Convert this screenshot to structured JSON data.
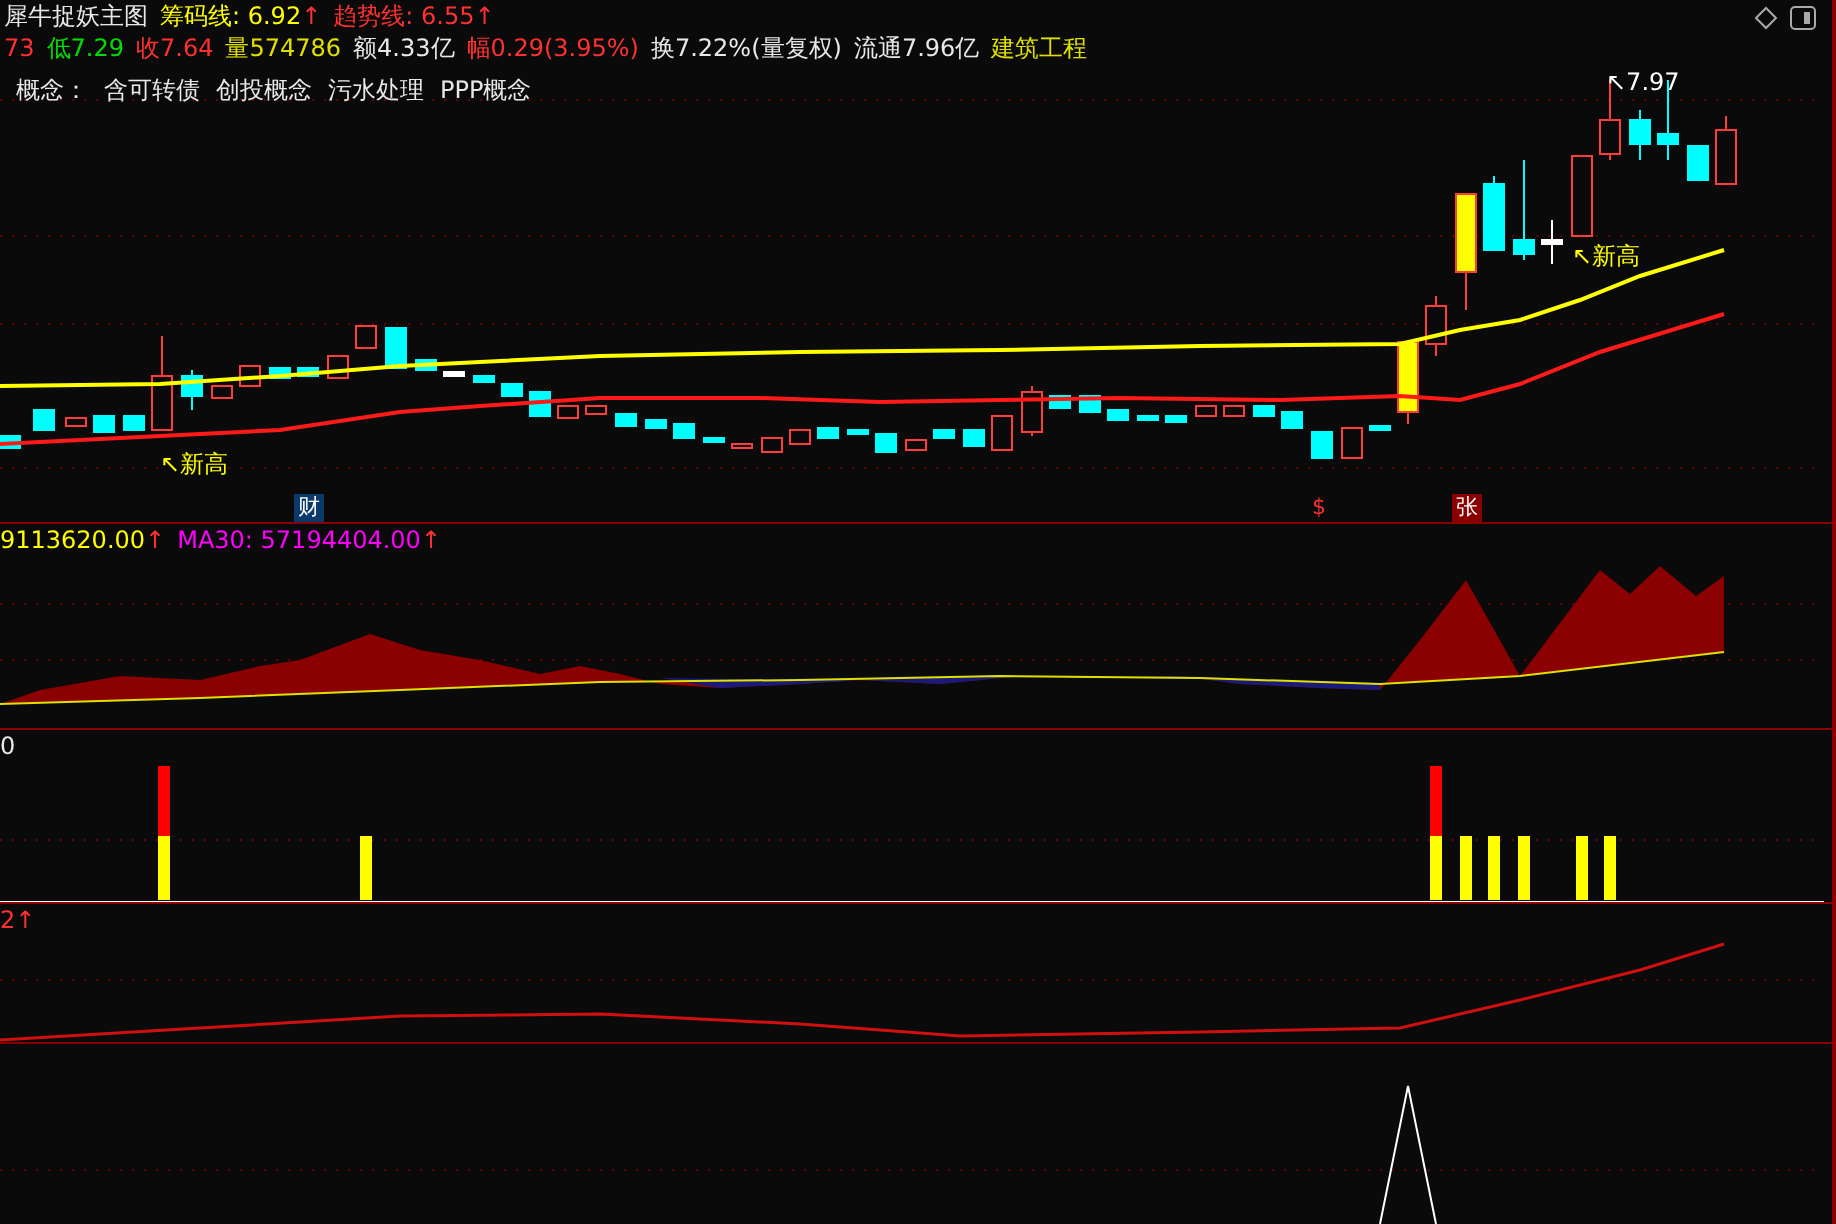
{
  "title": "犀牛捉妖主图",
  "main_indicators": [
    {
      "label": "筹码线: 6.92",
      "arrow": "↑",
      "color": "#ffff00"
    },
    {
      "label": "趋势线: 6.55",
      "arrow": "↑",
      "color": "#ff3030"
    }
  ],
  "quote": [
    {
      "text": "73",
      "color": "#ff3030"
    },
    {
      "text": "低7.29",
      "color": "#00e000"
    },
    {
      "text": "收7.64",
      "color": "#ff3030"
    },
    {
      "text": "量574786",
      "color": "#e0e000"
    },
    {
      "text": "额4.33亿",
      "color": "#e8e8e8"
    },
    {
      "text": "幅0.29(3.95%)",
      "color": "#ff3030"
    },
    {
      "text": "换7.22%(量复权)",
      "color": "#e8e8e8"
    },
    {
      "text": "流通7.96亿",
      "color": "#e8e8e8"
    },
    {
      "text": "建筑工程",
      "color": "#e0e000"
    }
  ],
  "concepts": {
    "label": "概念：",
    "items": [
      "含可转债",
      "创投概念",
      "污水处理",
      "PPP概念"
    ]
  },
  "high_price": "↖7.97",
  "new_high_labels": [
    "↖新高",
    "↖新高"
  ],
  "markers": [
    {
      "text": "财",
      "kind": "finance"
    },
    {
      "text": "$",
      "kind": "dollar"
    },
    {
      "text": "张",
      "kind": "rise"
    }
  ],
  "volume_panel": {
    "values": [
      {
        "text": "9113620.00",
        "arrow": "↑",
        "color": "#ffff00"
      },
      {
        "text": "MA30: 57194404.00",
        "arrow": "↑",
        "color": "#ff00ff"
      }
    ]
  },
  "signal_panel": {
    "label": "0"
  },
  "trend_panel": {
    "label": "2",
    "arrow": "↑"
  }
}
